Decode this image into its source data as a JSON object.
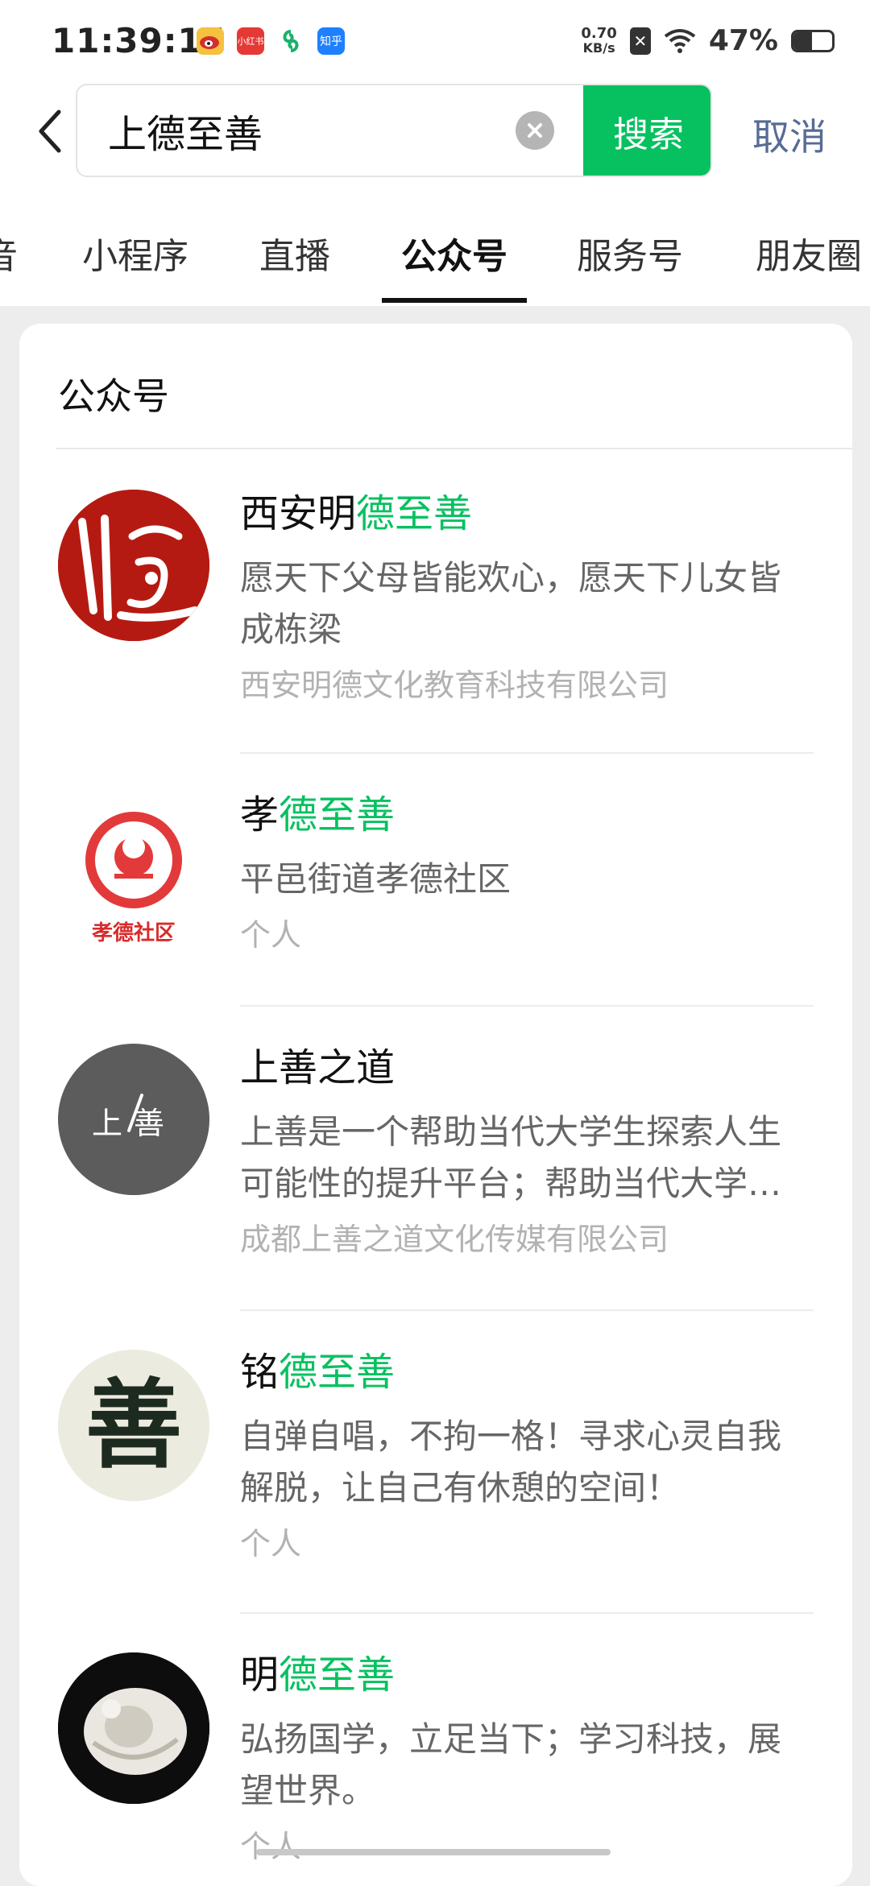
{
  "status_bar": {
    "time": "11:39:15",
    "app_icons": [
      "weibo-icon",
      "xiaohongshu-icon",
      "green-swirl-icon",
      "zhihu-icon"
    ],
    "app_icon_labels": {
      "xhs": "小红书",
      "zhihu": "知乎"
    },
    "net_speed_value": "0.70",
    "net_speed_unit": "KB/s",
    "battery_percent": "47%",
    "battery_level": 0.47
  },
  "search": {
    "query": "上德至善",
    "search_label": "搜索",
    "cancel_label": "取消"
  },
  "tabs": [
    {
      "label": "音"
    },
    {
      "label": "小程序"
    },
    {
      "label": "直播"
    },
    {
      "label": "公众号",
      "active": true
    },
    {
      "label": "服务号"
    },
    {
      "label": "朋友圈"
    }
  ],
  "section": {
    "title": "公众号"
  },
  "results": [
    {
      "name_plain": "西安明",
      "name_highlight": "德至善",
      "description": "愿天下父母皆能欢心，愿天下儿女皆成栋梁",
      "owner": "西安明德文化教育科技有限公司",
      "avatar": "xian-mingde-seal-avatar"
    },
    {
      "name_plain": "孝",
      "name_highlight": "德至善",
      "description": "平邑街道孝德社区",
      "owner": "个人",
      "avatar": "xiaode-community-avatar",
      "avatar_text": "孝德社区"
    },
    {
      "name_plain": "上善之道",
      "name_highlight": "",
      "description": "上善是一个帮助当代大学生探索人生可能性的提升平台；帮助当代大学…",
      "owner": "成都上善之道文化传媒有限公司",
      "avatar": "shangshan-avatar",
      "avatar_text": "上善"
    },
    {
      "name_plain": "铭",
      "name_highlight": "德至善",
      "description": "自弹自唱，不拘一格！寻求心灵自我解脱，让自己有休憩的空间！",
      "owner": "个人",
      "avatar": "shan-calligraphy-avatar",
      "avatar_text": "善"
    },
    {
      "name_plain": "明",
      "name_highlight": "德至善",
      "description": "弘扬国学，立足当下；学习科技，展望世界。",
      "owner": "个人",
      "avatar": "jade-ornament-avatar"
    }
  ],
  "colors": {
    "accent_green": "#07c160",
    "link_blue": "#576b95",
    "background": "#ededed"
  }
}
